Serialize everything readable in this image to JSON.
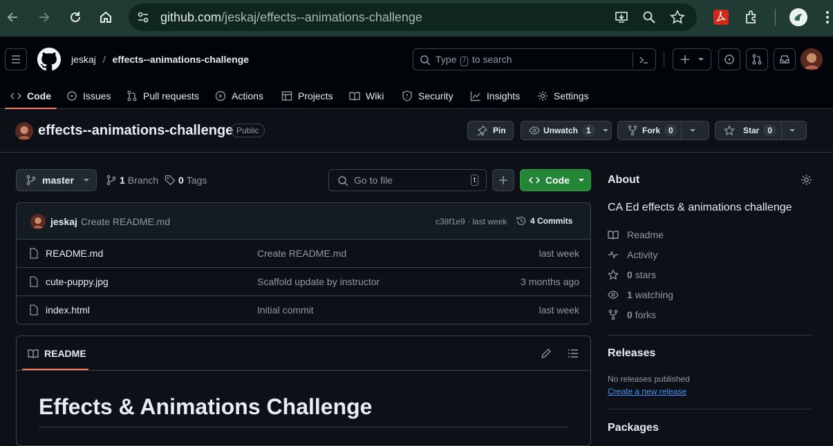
{
  "browser": {
    "url_host": "github.com",
    "url_path": "/jeskaj/effects--animations-challenge"
  },
  "header": {
    "owner": "jeskaj",
    "separator": "/",
    "repo": "effects--animations-challenge",
    "search_pre": "Type",
    "search_key": "/",
    "search_post": "to search",
    "tabs": [
      {
        "label": "Code",
        "icon": "code-icon"
      },
      {
        "label": "Issues",
        "icon": "issue-icon"
      },
      {
        "label": "Pull requests",
        "icon": "pull-request-icon"
      },
      {
        "label": "Actions",
        "icon": "play-icon"
      },
      {
        "label": "Projects",
        "icon": "table-icon"
      },
      {
        "label": "Wiki",
        "icon": "book-icon"
      },
      {
        "label": "Security",
        "icon": "shield-icon"
      },
      {
        "label": "Insights",
        "icon": "graph-icon"
      },
      {
        "label": "Settings",
        "icon": "gear-icon"
      }
    ]
  },
  "repo": {
    "name": "effects--animations-challenge",
    "visibility": "Public",
    "pin": "Pin",
    "unwatch": "Unwatch",
    "watch_count": "1",
    "fork": "Fork",
    "fork_count": "0",
    "star": "Star",
    "star_count": "0"
  },
  "toolbar": {
    "branch": "master",
    "branch_count": "1",
    "branch_label": "Branch",
    "tag_count": "0",
    "tag_label": "Tags",
    "goto_placeholder": "Go to file",
    "goto_key": "t",
    "code_button": "Code"
  },
  "commit": {
    "author": "jeskaj",
    "message": "Create README.md",
    "meta": "c38f1e9 · last week",
    "count": "4 Commits"
  },
  "files": [
    {
      "name": "README.md",
      "message": "Create README.md",
      "time": "last week"
    },
    {
      "name": "cute-puppy.jpg",
      "message": "Scaffold update by instructor",
      "time": "3 months ago"
    },
    {
      "name": "index.html",
      "message": "Initial commit",
      "time": "last week"
    }
  ],
  "readme": {
    "tab": "README",
    "heading": "Effects & Animations Challenge"
  },
  "about": {
    "title": "About",
    "description": "CA Ed effects & animations challenge",
    "readme": "Readme",
    "activity": "Activity",
    "stars_count": "0",
    "stars_label": "stars",
    "watching_count": "1",
    "watching_label": "watching",
    "forks_count": "0",
    "forks_label": "forks"
  },
  "releases": {
    "title": "Releases",
    "none": "No releases published",
    "create_link": "Create a new release"
  },
  "packages": {
    "title": "Packages"
  },
  "colors": {
    "accent_underline": "#f78166",
    "code_button": "#238636",
    "link": "#4493f8"
  }
}
